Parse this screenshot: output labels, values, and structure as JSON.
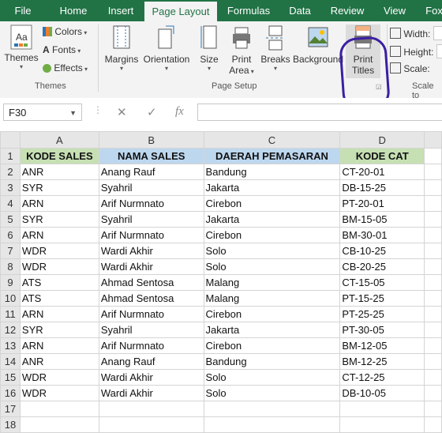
{
  "tabs": [
    "File",
    "Home",
    "Insert",
    "Page Layout",
    "Formulas",
    "Data",
    "Review",
    "View",
    "Fox"
  ],
  "ribbon": {
    "themes": {
      "label": "Themes",
      "colors": "Colors",
      "fonts": "Fonts",
      "effects": "Effects",
      "group": "Themes"
    },
    "page_setup": {
      "margins": "Margins",
      "orientation": "Orientation",
      "size": "Size",
      "print_area_1": "Print",
      "print_area_2": "Area",
      "breaks": "Breaks",
      "background": "Background",
      "print_titles_1": "Print",
      "print_titles_2": "Titles",
      "group": "Page Setup"
    },
    "scale": {
      "width": "Width:",
      "height": "Height:",
      "scale": "Scale:",
      "group": "Scale to"
    }
  },
  "formula_bar": {
    "name_box": "F30",
    "fx": "fx",
    "value": ""
  },
  "columns": [
    "A",
    "B",
    "C",
    "D"
  ],
  "headers": [
    "KODE SALES",
    "NAMA SALES",
    "DAERAH PEMASARAN",
    "KODE  CAT"
  ],
  "rows": [
    [
      "ANR",
      "Anang Rauf",
      "Bandung",
      "CT-20-01"
    ],
    [
      "SYR",
      "Syahril",
      "Jakarta",
      "DB-15-25"
    ],
    [
      "ARN",
      "Arif Nurmnato",
      "Cirebon",
      "PT-20-01"
    ],
    [
      "SYR",
      "Syahril",
      "Jakarta",
      "BM-15-05"
    ],
    [
      "ARN",
      "Arif Nurmnato",
      "Cirebon",
      "BM-30-01"
    ],
    [
      "WDR",
      "Wardi Akhir",
      "Solo",
      "CB-10-25"
    ],
    [
      "WDR",
      "Wardi Akhir",
      "Solo",
      "CB-20-25"
    ],
    [
      "ATS",
      "Ahmad Sentosa",
      "Malang",
      "CT-15-05"
    ],
    [
      "ATS",
      "Ahmad Sentosa",
      "Malang",
      "PT-15-25"
    ],
    [
      "ARN",
      "Arif Nurmnato",
      "Cirebon",
      "PT-25-25"
    ],
    [
      "SYR",
      "Syahril",
      "Jakarta",
      "PT-30-05"
    ],
    [
      "ARN",
      "Arif Nurmnato",
      "Cirebon",
      "BM-12-05"
    ],
    [
      "ANR",
      "Anang Rauf",
      "Bandung",
      "BM-12-25"
    ],
    [
      "WDR",
      "Wardi Akhir",
      "Solo",
      "CT-12-25"
    ],
    [
      "WDR",
      "Wardi Akhir",
      "Solo",
      "DB-10-05"
    ]
  ],
  "row_numbers": [
    "1",
    "2",
    "3",
    "4",
    "5",
    "6",
    "7",
    "8",
    "9",
    "10",
    "11",
    "12",
    "13",
    "14",
    "15",
    "16",
    "17",
    "18"
  ]
}
